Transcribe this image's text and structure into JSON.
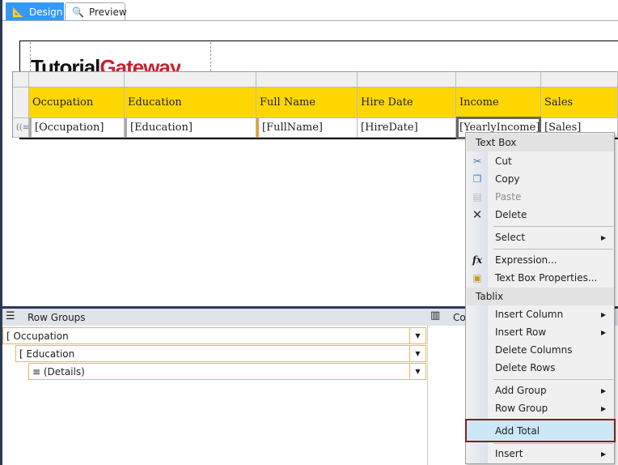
{
  "tabs": [
    {
      "label": "Design",
      "icon": "design-ruler-icon"
    },
    {
      "label": "Preview",
      "icon": "preview-icon"
    }
  ],
  "logo": {
    "part1": "Tutorial",
    "part2": "Gateway"
  },
  "table": {
    "headers": [
      "Occupation",
      "Education",
      "Full Name",
      "Hire Date",
      "Income",
      "Sales"
    ],
    "fields": [
      "[Occupation]",
      "[Education]",
      "[FullName]",
      "[HireDate]",
      "[YearlyIncome]",
      "[Sales]"
    ]
  },
  "panel": {
    "row_groups_label": "Row Groups",
    "column_groups_label": "Co",
    "groups": [
      {
        "label": "Occupation"
      },
      {
        "label": "Education"
      },
      {
        "label": "(Details)"
      }
    ]
  },
  "menu": {
    "textbox_header": "Text Box",
    "cut": "Cut",
    "copy": "Copy",
    "paste": "Paste",
    "delete": "Delete",
    "select": "Select",
    "expression": "Expression...",
    "textbox_props": "Text Box Properties...",
    "tablix_header": "Tablix",
    "insert_column": "Insert Column",
    "insert_row": "Insert Row",
    "delete_columns": "Delete Columns",
    "delete_rows": "Delete Rows",
    "add_group": "Add Group",
    "row_group": "Row Group",
    "add_total": "Add Total",
    "insert": "Insert"
  },
  "colors": {
    "header_fill": "#ffd700",
    "tab_active": "#3399ff",
    "highlight_border": "#8b1a1a"
  }
}
